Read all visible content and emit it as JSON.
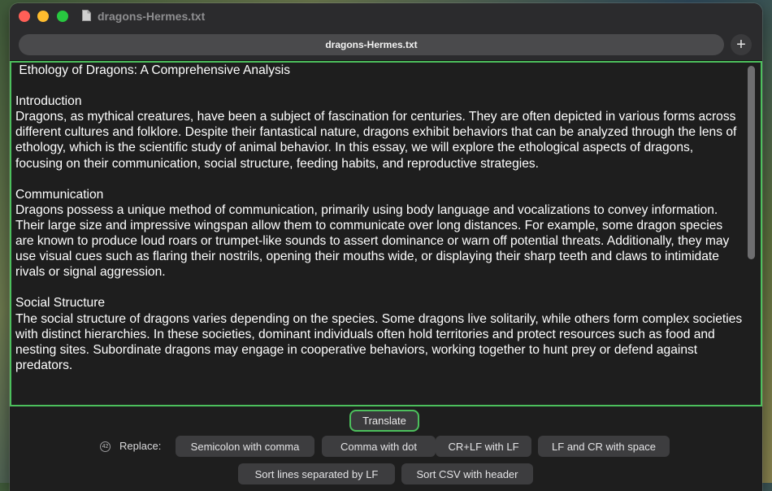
{
  "window": {
    "title": "dragons-Hermes.txt"
  },
  "tabs": [
    {
      "label": "dragons-Hermes.txt"
    }
  ],
  "editor": {
    "content": " Ethology of Dragons: A Comprehensive Analysis\n\nIntroduction\nDragons, as mythical creatures, have been a subject of fascination for centuries. They are often depicted in various forms across different cultures and folklore. Despite their fantastical nature, dragons exhibit behaviors that can be analyzed through the lens of ethology, which is the scientific study of animal behavior. In this essay, we will explore the ethological aspects of dragons, focusing on their communication, social structure, feeding habits, and reproductive strategies.\n\nCommunication\nDragons possess a unique method of communication, primarily using body language and vocalizations to convey information. Their large size and impressive wingspan allow them to communicate over long distances. For example, some dragon species are known to produce loud roars or trumpet-like sounds to assert dominance or warn off potential threats. Additionally, they may use visual cues such as flaring their nostrils, opening their mouths wide, or displaying their sharp teeth and claws to intimidate rivals or signal aggression.\n\nSocial Structure\nThe social structure of dragons varies depending on the species. Some dragons live solitarily, while others form complex societies with distinct hierarchies. In these societies, dominant individuals often hold territories and protect resources such as food and nesting sites. Subordinate dragons may engage in cooperative behaviors, working together to hunt prey or defend against predators."
  },
  "actions": {
    "translate_label": "Translate",
    "replace_label": "Replace:",
    "replace_badge": "42",
    "replace_options": [
      "Semicolon with comma",
      "Comma with dot",
      "CR+LF with LF",
      "LF and CR with space",
      "Sort lines separated by LF",
      "Sort CSV with header"
    ]
  },
  "colors": {
    "focus_ring": "#4cbf5c",
    "close": "#ff5f57",
    "minimize": "#febc2e",
    "maximize": "#28c840"
  }
}
